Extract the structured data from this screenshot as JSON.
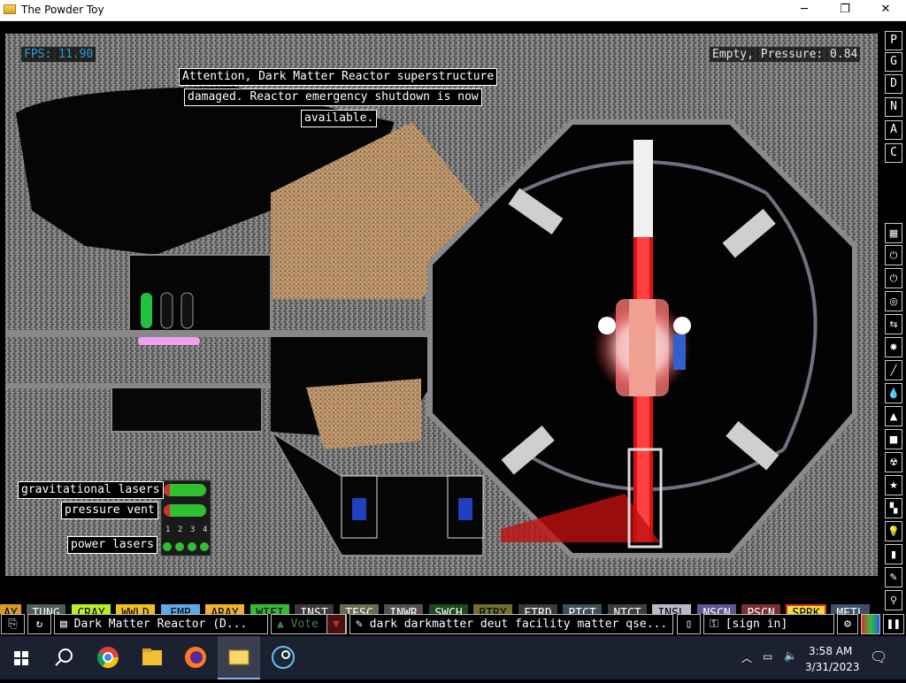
{
  "window": {
    "title": "The Powder Toy",
    "minimize_glyph": "─",
    "maximize_glyph": "❐",
    "close_glyph": "✕"
  },
  "hud": {
    "fps": "FPS: 11.90",
    "pressure": "Empty, Pressure: 0.84"
  },
  "alert": {
    "line1": "Attention, Dark Matter Reactor superstructure",
    "line2": "damaged. Reactor emergency shutdown is now",
    "line3": "available."
  },
  "signs": {
    "grav_lasers": "gravitational lasers",
    "pressure_vent": "pressure vent",
    "power_lasers": "power lasers",
    "switch_numbers": [
      "1",
      "2",
      "3",
      "4"
    ]
  },
  "side_menu_letters": [
    "P",
    "G",
    "D",
    "N",
    "A",
    "C"
  ],
  "side_tools": [
    {
      "name": "walls-icon",
      "glyph": "▦"
    },
    {
      "name": "electronics-icon",
      "glyph": "⏻"
    },
    {
      "name": "powered-icon",
      "glyph": "⏻"
    },
    {
      "name": "sensors-icon",
      "glyph": "◎"
    },
    {
      "name": "force-icon",
      "glyph": "⇆"
    },
    {
      "name": "explosives-icon",
      "glyph": "✸"
    },
    {
      "name": "gases-icon",
      "glyph": "╱"
    },
    {
      "name": "liquids-icon",
      "glyph": "💧"
    },
    {
      "name": "powders-icon",
      "glyph": "▲"
    },
    {
      "name": "solids-icon",
      "glyph": "■"
    },
    {
      "name": "radioactive-icon",
      "glyph": "☢"
    },
    {
      "name": "special-icon",
      "glyph": "★"
    },
    {
      "name": "life-icon",
      "glyph": "▚"
    },
    {
      "name": "tools-icon",
      "glyph": "💡"
    },
    {
      "name": "favorites-icon",
      "glyph": "▮"
    },
    {
      "name": "decoration-icon",
      "glyph": "✎"
    },
    {
      "name": "search-icon",
      "glyph": "⚲"
    }
  ],
  "elements": [
    {
      "label": "AY",
      "bg": "#d89a2a",
      "fg": "#000000"
    },
    {
      "label": "TUNG",
      "bg": "#505a5a",
      "fg": "#ffffff"
    },
    {
      "label": "CRAY",
      "bg": "#b8f028",
      "fg": "#000000"
    },
    {
      "label": "WWLD",
      "bg": "#f0c020",
      "fg": "#000000"
    },
    {
      "label": "EMP",
      "bg": "#60a8e8",
      "fg": "#000000"
    },
    {
      "label": "ARAY",
      "bg": "#f0b030",
      "fg": "#000000"
    },
    {
      "label": "WIFI",
      "bg": "#38b838",
      "fg": "#000000"
    },
    {
      "label": "INST",
      "bg": "#3a3a3a",
      "fg": "#ffffff"
    },
    {
      "label": "TESC",
      "bg": "#6a6a50",
      "fg": "#ffffff"
    },
    {
      "label": "INWR",
      "bg": "#545050",
      "fg": "#ffffff"
    },
    {
      "label": "SWCH",
      "bg": "#1c4a1c",
      "fg": "#ffffff"
    },
    {
      "label": "BTRY",
      "bg": "#707030",
      "fg": "#000000"
    },
    {
      "label": "ETRD",
      "bg": "#3a3a3a",
      "fg": "#ffffff"
    },
    {
      "label": "PTCT",
      "bg": "#385058",
      "fg": "#ffffff"
    },
    {
      "label": "NTCT",
      "bg": "#384038",
      "fg": "#ffffff"
    },
    {
      "label": "INSL",
      "bg": "#b8b8c8",
      "fg": "#000000"
    },
    {
      "label": "NSCN",
      "bg": "#5a5a90",
      "fg": "#ffffff"
    },
    {
      "label": "PSCN",
      "bg": "#7a3030",
      "fg": "#ffffff"
    },
    {
      "label": "SPRK",
      "bg": "#f0e040",
      "fg": "#000000",
      "selected": true
    },
    {
      "label": "METL",
      "bg": "#40506a",
      "fg": "#ffffff"
    }
  ],
  "menubar": {
    "open_glyph": "⎘",
    "reload_glyph": "↻",
    "save_name": "Dark Matter Reactor (D...",
    "vote_label": "Vote",
    "tags": "dark darkmatter deut facility matter qse...",
    "new_glyph": "▯",
    "sign_in": "[sign in]"
  },
  "taskbar": {
    "time": "3:58 AM",
    "date": "3/31/2023"
  }
}
